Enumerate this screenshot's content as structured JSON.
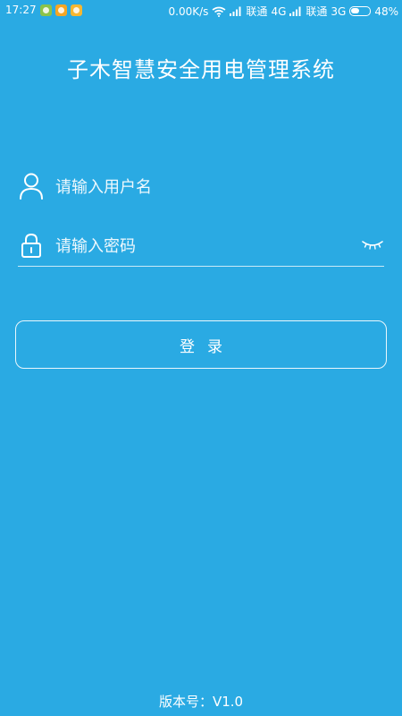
{
  "status_bar": {
    "time": "17:27",
    "speed": "0.00K/s",
    "carrier1": "联通",
    "net1": "4G",
    "carrier2": "联通",
    "net2": "3G",
    "battery": "48%",
    "battery_level": 0.48,
    "icons": [
      "app-badge-icon",
      "app-badge-icon",
      "app-badge-icon",
      "wifi-icon",
      "signal-icon",
      "signal-icon",
      "battery-icon"
    ]
  },
  "app": {
    "title": "子木智慧安全用电管理系统"
  },
  "login": {
    "username_placeholder": "请输入用户名",
    "password_placeholder": "请输入密码",
    "submit_label": "登录"
  },
  "footer": {
    "version": "版本号：V1.0"
  },
  "colors": {
    "background": "#2aaae3",
    "text": "#ffffff"
  }
}
